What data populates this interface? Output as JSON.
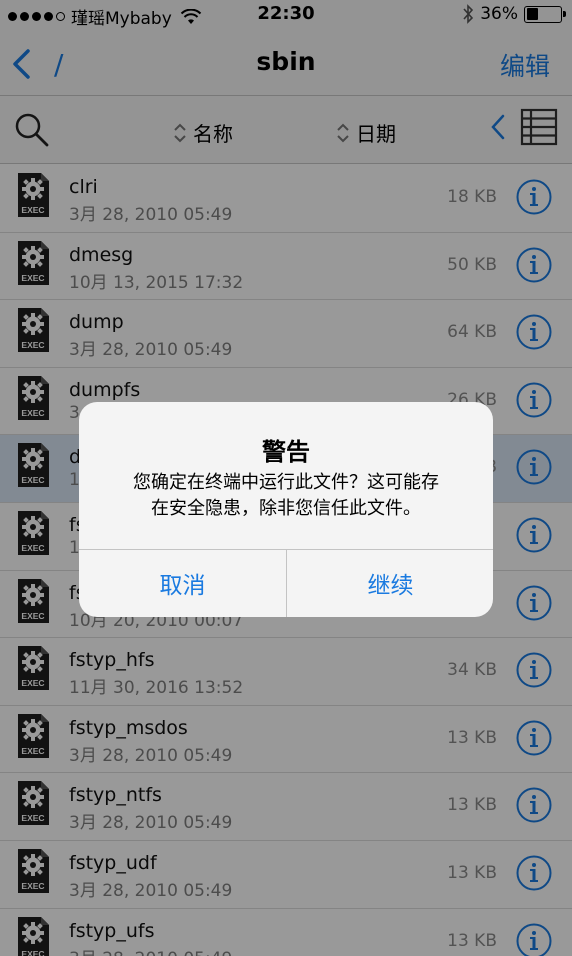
{
  "status_bar": {
    "carrier": "瑾瑶Mybaby",
    "time": "22:30",
    "battery": "36%",
    "battery_level": 0.36
  },
  "nav": {
    "path": "/",
    "title": "sbin",
    "edit_label": "编辑"
  },
  "toolbar": {
    "sort_name_label": "名称",
    "sort_date_label": "日期"
  },
  "icons": {
    "file": "exec-file-icon",
    "file_badge": "EXEC",
    "info": "info-icon",
    "search": "search-icon",
    "back": "chevron-left-icon",
    "list": "list-view-icon"
  },
  "colors": {
    "accent": "#1a7ae0",
    "selected_row": "#d9e6f6"
  },
  "files": [
    {
      "name": "clri",
      "date": "3月 28, 2010 05:49",
      "size": "18 KB"
    },
    {
      "name": "dmesg",
      "date": "10月 13, 2015 17:32",
      "size": "50 KB"
    },
    {
      "name": "dump",
      "date": "3月 28, 2010 05:49",
      "size": "64 KB"
    },
    {
      "name": "dumpfs",
      "date": "3",
      "size": "26 KB"
    },
    {
      "name": "d",
      "date": "1",
      "size": "B"
    },
    {
      "name": "fs",
      "date": "1",
      "size": ""
    },
    {
      "name": "fs",
      "date": "10月 20, 2010 00:07",
      "size": ""
    },
    {
      "name": "fstyp_hfs",
      "date": "11月 30, 2016 13:52",
      "size": "34 KB"
    },
    {
      "name": "fstyp_msdos",
      "date": "3月 28, 2010 05:49",
      "size": "13 KB"
    },
    {
      "name": "fstyp_ntfs",
      "date": "3月 28, 2010 05:49",
      "size": "13 KB"
    },
    {
      "name": "fstyp_udf",
      "date": "3月 28, 2010 05:49",
      "size": "13 KB"
    },
    {
      "name": "fstyp_ufs",
      "date": "3月 28, 2010 05:49",
      "size": "13 KB"
    }
  ],
  "dialog": {
    "title": "警告",
    "message_line1": "您确定在终端中运行此文件？这可能存",
    "message_line2": "在安全隐患，除非您信任此文件。",
    "cancel_label": "取消",
    "continue_label": "继续"
  }
}
